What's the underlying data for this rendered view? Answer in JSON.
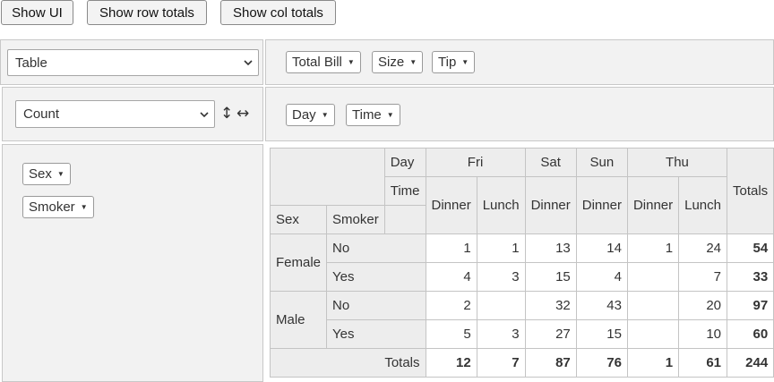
{
  "toolbar": {
    "show_ui": "Show UI",
    "show_row_totals": "Show row totals",
    "show_col_totals": "Show col totals"
  },
  "renderer": {
    "selected": "Table"
  },
  "aggregator": {
    "selected": "Count"
  },
  "unused_attrs": [
    "Total Bill",
    "Size",
    "Tip"
  ],
  "col_attrs": [
    "Day",
    "Time"
  ],
  "row_attrs": [
    "Sex",
    "Smoker"
  ],
  "pivot": {
    "col_attr_labels": [
      "Day",
      "Time"
    ],
    "row_attr_labels": [
      "Sex",
      "Smoker"
    ],
    "days": [
      {
        "name": "Fri",
        "span": 2
      },
      {
        "name": "Sat",
        "span": 1
      },
      {
        "name": "Sun",
        "span": 1
      },
      {
        "name": "Thu",
        "span": 2
      }
    ],
    "times": [
      "Dinner",
      "Lunch",
      "Dinner",
      "Dinner",
      "Dinner",
      "Lunch"
    ],
    "totals_label": "Totals",
    "rows": [
      {
        "sex": "Female",
        "smoker": "No",
        "cells": [
          "1",
          "1",
          "13",
          "14",
          "1",
          "24"
        ],
        "total": "54"
      },
      {
        "sex": "Female",
        "smoker": "Yes",
        "cells": [
          "4",
          "3",
          "15",
          "4",
          "",
          "7"
        ],
        "total": "33"
      },
      {
        "sex": "Male",
        "smoker": "No",
        "cells": [
          "2",
          "",
          "32",
          "43",
          "",
          "20"
        ],
        "total": "97"
      },
      {
        "sex": "Male",
        "smoker": "Yes",
        "cells": [
          "5",
          "3",
          "27",
          "15",
          "",
          "10"
        ],
        "total": "60"
      }
    ],
    "col_totals": [
      "12",
      "7",
      "87",
      "76",
      "1",
      "61"
    ],
    "grand_total": "244"
  }
}
